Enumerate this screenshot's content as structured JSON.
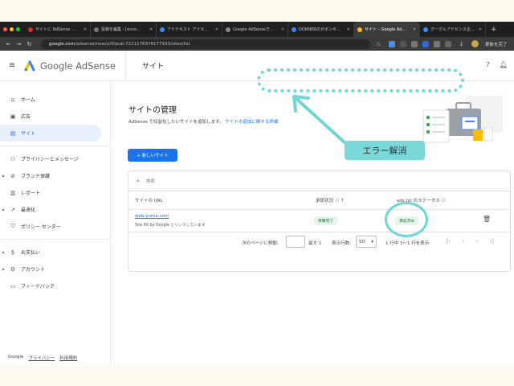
{
  "browser": {
    "tabs": [
      {
        "label": "サイトに AdSense …",
        "color": "#d93025"
      },
      {
        "label": "投稿を編集 ‹ [ecco…",
        "color": "#777777"
      },
      {
        "label": "アドテキスト アドセ…",
        "color": "#4285f4"
      },
      {
        "label": "Google AdSenseで…",
        "color": "#888888"
      },
      {
        "label": "DONNERのガボンギ…",
        "color": "#3b82f6"
      },
      {
        "label": "サイト – Google Ad…",
        "color": "#fbbc04"
      },
      {
        "label": "グーグルアドセンス企…",
        "color": "#4285f4"
      }
    ],
    "url_host": "google.com",
    "url_path": "/adsense/new/u/0/pub-7221176978177933/sites/list",
    "profile_label": "更新を完了"
  },
  "header": {
    "brand": "Google AdSense",
    "title": "サイト"
  },
  "sidebar": {
    "items": [
      {
        "label": "ホーム",
        "icon": "home-icon"
      },
      {
        "label": "広告",
        "icon": "ads-icon"
      },
      {
        "label": "サイト",
        "icon": "sites-icon"
      },
      {
        "label": "プライバシーとメッセージ",
        "icon": "privacy-icon"
      },
      {
        "label": "ブランド保護",
        "icon": "block-icon"
      },
      {
        "label": "レポート",
        "icon": "report-icon"
      },
      {
        "label": "最適化",
        "icon": "optimize-icon"
      },
      {
        "label": "ポリシー センター",
        "icon": "shield-icon"
      },
      {
        "label": "お支払い",
        "icon": "payment-icon"
      },
      {
        "label": "アカウント",
        "icon": "gear-icon"
      },
      {
        "label": "フィードバック",
        "icon": "feedback-icon"
      }
    ],
    "footer": {
      "google": "Google",
      "privacy": "プライバシー",
      "terms": "利用規約"
    }
  },
  "main": {
    "title": "サイトの管理",
    "desc": "AdSense で収益化したいサイトを追加します。",
    "desc_link": "サイトの追加に関する詳細",
    "new_site_button": "+ 新しいサイト",
    "search_placeholder": "検索",
    "columns": {
      "url": "サイトの URL",
      "status": "承認状況 ⓘ ↑",
      "ads_txt": "ads.txt のステータス ⓘ"
    },
    "rows": [
      {
        "url": "web-yuma.com",
        "sub": "Site Kit by Google とリンクしています",
        "status": "準備完了",
        "ads_txt": "承認済み"
      }
    ],
    "pager": {
      "goto": "次のページに移動:",
      "max": "最大 1",
      "rows_label": "表示行数:",
      "rows_value": "50",
      "range": "1 行中 1〜1 行を表示"
    }
  },
  "annotation": {
    "callout": "エラー解消",
    "color": "#6fd6d4"
  }
}
